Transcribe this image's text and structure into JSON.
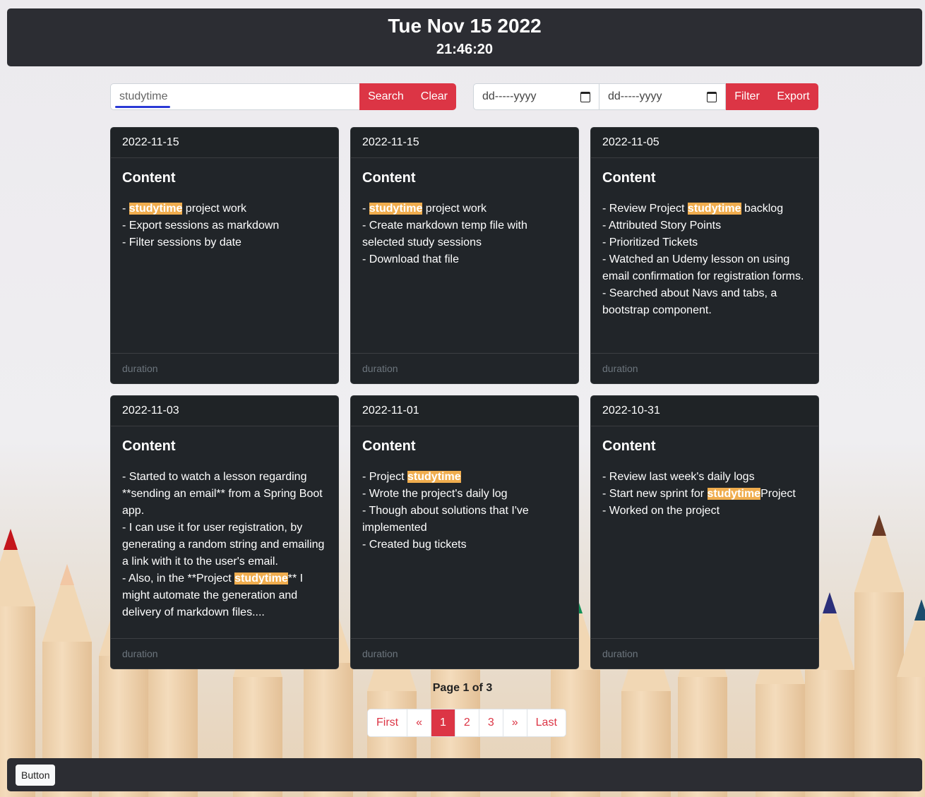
{
  "header": {
    "date": "Tue Nov 15 2022",
    "time": "21:46:20"
  },
  "search": {
    "value": "studytime",
    "search_label": "Search",
    "clear_label": "Clear"
  },
  "filter": {
    "from_placeholder": "dd-----yyyy",
    "to_placeholder": "dd-----yyyy",
    "filter_label": "Filter",
    "export_label": "Export"
  },
  "highlight_term": "studytime",
  "colors": {
    "accent": "#dc3545",
    "highlight": "#f0ad4e",
    "card_bg": "#212529",
    "bar_bg": "#2c2d33"
  },
  "cards": [
    {
      "date": "2022-11-15",
      "title": "Content",
      "lines": [
        "- [[studytime]] project work",
        "- Export sessions as markdown",
        "- Filter sessions by date"
      ],
      "footer": "duration"
    },
    {
      "date": "2022-11-15",
      "title": "Content",
      "lines": [
        "- [[studytime]] project work",
        "- Create markdown temp file with selected study sessions",
        "- Download that file"
      ],
      "footer": "duration"
    },
    {
      "date": "2022-11-05",
      "title": "Content",
      "lines": [
        "- Review Project [[studytime]] backlog",
        "- Attributed Story Points",
        "- Prioritized Tickets",
        "- Watched an Udemy lesson on using email confirmation for registration forms.",
        "- Searched about Navs and tabs, a bootstrap component."
      ],
      "footer": "duration"
    },
    {
      "date": "2022-11-03",
      "title": "Content",
      "lines": [
        "- Started to watch a lesson regarding **sending an email** from a Spring Boot app.",
        "- I can use it for user registration, by generating a random string and emailing a link with it to the user's email.",
        "- Also, in the **Project [[studytime]]** I might automate the generation and delivery of markdown files...."
      ],
      "footer": "duration"
    },
    {
      "date": "2022-11-01",
      "title": "Content",
      "lines": [
        "- Project [[studytime]]",
        "- Wrote the project's daily log",
        "- Though about solutions that I've implemented",
        "- Created bug tickets"
      ],
      "footer": "duration"
    },
    {
      "date": "2022-10-31",
      "title": "Content",
      "lines": [
        "- Review last week's daily logs",
        "- Start new sprint for [[studytime]]Project",
        "- Worked on the project"
      ],
      "footer": "duration"
    }
  ],
  "pagination": {
    "label": "Page 1 of 3",
    "items": [
      "First",
      "«",
      "1",
      "2",
      "3",
      "»",
      "Last"
    ],
    "active": "1"
  },
  "footer": {
    "button_label": "Button"
  }
}
